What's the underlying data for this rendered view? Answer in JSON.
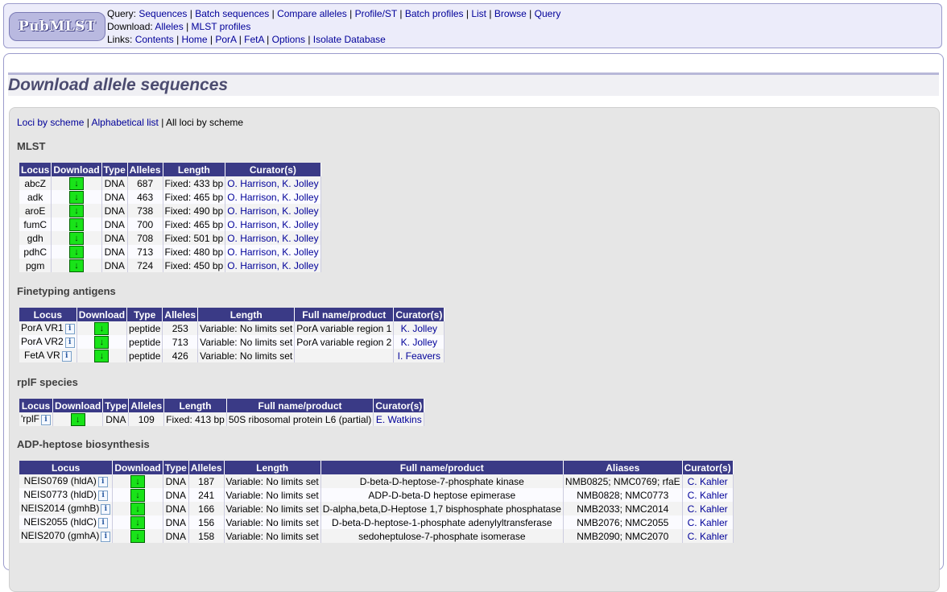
{
  "logo": "PubMLST",
  "menu": {
    "query_label": "Query:",
    "query_links": [
      "Sequences",
      "Batch sequences",
      "Compare alleles",
      "Profile/ST",
      "Batch profiles",
      "List",
      "Browse",
      "Query"
    ],
    "download_label": "Download:",
    "download_links": [
      "Alleles",
      "MLST profiles"
    ],
    "links_label": "Links:",
    "links_links": [
      "Contents",
      "Home",
      "PorA",
      "FetA",
      "Options",
      "Isolate Database"
    ]
  },
  "page_title": "Download allele sequences",
  "nav": {
    "loci_by_scheme": "Loci by scheme",
    "alphabetical": "Alphabetical list",
    "all_loci": "All loci by scheme"
  },
  "download_icon": "download-arrow-icon",
  "info_icon": "info-icon",
  "schemes": [
    {
      "name": "MLST",
      "headers": [
        "Locus",
        "Download",
        "Type",
        "Alleles",
        "Length",
        "Curator(s)"
      ],
      "rows": [
        {
          "locus": "abcZ",
          "type": "DNA",
          "alleles": "687",
          "length": "Fixed: 433 bp",
          "curators": "O. Harrison, K. Jolley"
        },
        {
          "locus": "adk",
          "type": "DNA",
          "alleles": "463",
          "length": "Fixed: 465 bp",
          "curators": "O. Harrison, K. Jolley"
        },
        {
          "locus": "aroE",
          "type": "DNA",
          "alleles": "738",
          "length": "Fixed: 490 bp",
          "curators": "O. Harrison, K. Jolley"
        },
        {
          "locus": "fumC",
          "type": "DNA",
          "alleles": "700",
          "length": "Fixed: 465 bp",
          "curators": "O. Harrison, K. Jolley"
        },
        {
          "locus": "gdh",
          "type": "DNA",
          "alleles": "708",
          "length": "Fixed: 501 bp",
          "curators": "O. Harrison, K. Jolley"
        },
        {
          "locus": "pdhC",
          "type": "DNA",
          "alleles": "713",
          "length": "Fixed: 480 bp",
          "curators": "O. Harrison, K. Jolley"
        },
        {
          "locus": "pgm",
          "type": "DNA",
          "alleles": "724",
          "length": "Fixed: 450 bp",
          "curators": "O. Harrison, K. Jolley"
        }
      ]
    },
    {
      "name": "Finetyping antigens",
      "headers": [
        "Locus",
        "Download",
        "Type",
        "Alleles",
        "Length",
        "Full name/product",
        "Curator(s)"
      ],
      "rows": [
        {
          "locus": "PorA VR1",
          "type": "peptide",
          "alleles": "253",
          "length": "Variable: No limits set",
          "product": "PorA variable region 1",
          "curators": "K. Jolley"
        },
        {
          "locus": "PorA VR2",
          "type": "peptide",
          "alleles": "713",
          "length": "Variable: No limits set",
          "product": "PorA variable region 2",
          "curators": "K. Jolley"
        },
        {
          "locus": "FetA VR",
          "type": "peptide",
          "alleles": "426",
          "length": "Variable: No limits set",
          "product": "",
          "curators": "I. Feavers"
        }
      ]
    },
    {
      "name": "rplF species",
      "headers": [
        "Locus",
        "Download",
        "Type",
        "Alleles",
        "Length",
        "Full name/product",
        "Curator(s)"
      ],
      "rows": [
        {
          "locus": "'rplF",
          "type": "DNA",
          "alleles": "109",
          "length": "Fixed: 413 bp",
          "product": "50S ribosomal protein L6 (partial)",
          "curators": "E. Watkins"
        }
      ]
    },
    {
      "name": "ADP-heptose biosynthesis",
      "headers": [
        "Locus",
        "Download",
        "Type",
        "Alleles",
        "Length",
        "Full name/product",
        "Aliases",
        "Curator(s)"
      ],
      "rows": [
        {
          "locus": "NEIS0769 (hldA)",
          "type": "DNA",
          "alleles": "187",
          "length": "Variable: No limits set",
          "product": "D-beta-D-heptose-7-phosphate kinase",
          "aliases": "NMB0825; NMC0769; rfaE",
          "curators": "C. Kahler"
        },
        {
          "locus": "NEIS0773 (hldD)",
          "type": "DNA",
          "alleles": "241",
          "length": "Variable: No limits set",
          "product": "ADP-D-beta-D heptose epimerase",
          "aliases": "NMB0828; NMC0773",
          "curators": "C. Kahler"
        },
        {
          "locus": "NEIS2014 (gmhB)",
          "type": "DNA",
          "alleles": "166",
          "length": "Variable: No limits set",
          "product": "D-alpha,beta,D-Heptose 1,7 bisphosphate phosphatase",
          "aliases": "NMB2033; NMC2014",
          "curators": "C. Kahler"
        },
        {
          "locus": "NEIS2055 (hldC)",
          "type": "DNA",
          "alleles": "156",
          "length": "Variable: No limits set",
          "product": "D-beta-D-heptose-1-phosphate adenylyltransferase",
          "aliases": "NMB2076; NMC2055",
          "curators": "C. Kahler"
        },
        {
          "locus": "NEIS2070 (gmhA)",
          "type": "DNA",
          "alleles": "158",
          "length": "Variable: No limits set",
          "product": "sedoheptulose-7-phosphate isomerase",
          "aliases": "NMB2090; NMC2070",
          "curators": "C. Kahler"
        }
      ]
    }
  ]
}
